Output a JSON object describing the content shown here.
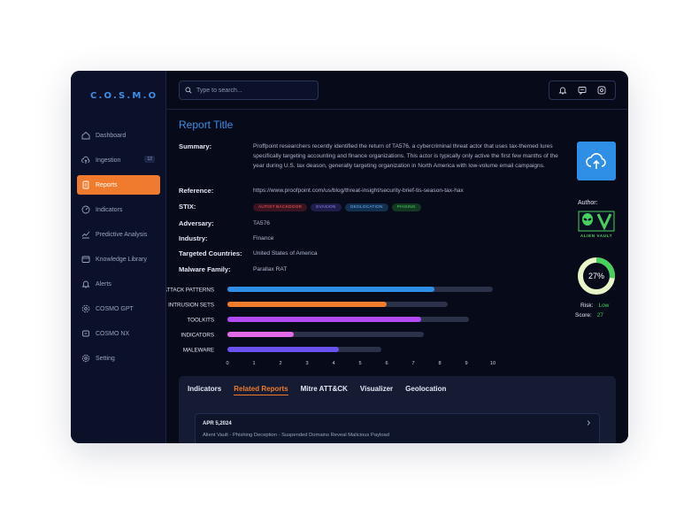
{
  "app": {
    "logo_text": "C.O.S.M.O"
  },
  "sidebar": {
    "items": [
      {
        "label": "Dashboard",
        "icon": "home-icon"
      },
      {
        "label": "Ingestion",
        "icon": "cloud-upload-icon",
        "badge": "12"
      },
      {
        "label": "Reports",
        "icon": "document-icon",
        "active": true
      },
      {
        "label": "Indicators",
        "icon": "gauge-icon"
      },
      {
        "label": "Predictive Analysis",
        "icon": "chart-line-icon"
      },
      {
        "label": "Knowledge Library",
        "icon": "library-icon"
      },
      {
        "label": "Alerts",
        "icon": "bell-icon"
      },
      {
        "label": "COSMO GPT",
        "icon": "gear-chat-icon"
      },
      {
        "label": "COSMO NX",
        "icon": "cube-icon"
      },
      {
        "label": "Setting",
        "icon": "gear-icon"
      }
    ]
  },
  "header": {
    "search_placeholder": "Type to search..."
  },
  "report": {
    "title": "Report Title",
    "summary_label": "Summary:",
    "summary": "Proffpoint researchers recently identified the return of TA576, a cybercriminal threat actor that uses tax-themed lures specifically targeting accounting and finance organizations. This actor is typically only active the first few manths of the year during U.S. tax deason, generally targeting organization in North America with low-volume email campaigns.",
    "reference_label": "Reference:",
    "reference": "https://www.proofpoint.com/us/blog/threat-insight/security-brief-tis-season-tax-hax",
    "stix_label": "STIX:",
    "stix_tags": [
      {
        "label": "AUTOIT BACKDOOR",
        "color": "#ff5a5a",
        "bg": "#3a1420"
      },
      {
        "label": "EVASION",
        "color": "#8f86ff",
        "bg": "#1f1d4a"
      },
      {
        "label": "GEOLOCATION",
        "color": "#6fb2ff",
        "bg": "#12304f"
      },
      {
        "label": "PHISING",
        "color": "#4fd160",
        "bg": "#123a22"
      }
    ],
    "adversary_label": "Adversary:",
    "adversary": "TA576",
    "industry_label": "Industry:",
    "industry": "Finance",
    "countries_label": "Targeted Countries:",
    "countries": "United States of America",
    "malware_label": "Malware Family:",
    "malware": "Parallax RAT"
  },
  "author": {
    "label": "Author:",
    "logo_text": "ALIEN VAULT"
  },
  "risk": {
    "percent": 27,
    "percent_label": "27%",
    "risk_label": "Risk:",
    "risk_value": "Low",
    "score_label": "Score:",
    "score_value": "27"
  },
  "chart_data": {
    "type": "bar",
    "orientation": "horizontal",
    "categories": [
      "ATTACK PATTERNS",
      "INTRUSION SETS",
      "TOOLKITS",
      "INDICATORS",
      "MALEWARE"
    ],
    "values": [
      7.8,
      6.0,
      7.3,
      2.5,
      4.2
    ],
    "totals": [
      10,
      8.3,
      9.1,
      7.4,
      5.8
    ],
    "colors": [
      "#2f8fe6",
      "#f07b2c",
      "#b24bf3",
      "#e26ae6",
      "#6a52f0"
    ],
    "xlim": [
      0,
      10
    ],
    "ticks": [
      "0",
      "1",
      "2",
      "3",
      "4",
      "5",
      "6",
      "7",
      "8",
      "9",
      "10"
    ]
  },
  "tabs": [
    {
      "label": "Indicators"
    },
    {
      "label": "Related Reports",
      "active": true
    },
    {
      "label": "Mitre ATT&CK"
    },
    {
      "label": "Visualizer"
    },
    {
      "label": "Geolocation"
    }
  ],
  "related": [
    {
      "date": "APR 5,2024",
      "title": "Alient Vault - Phishing Deception - Suspended Domains Reveal Malicious Payload"
    }
  ]
}
